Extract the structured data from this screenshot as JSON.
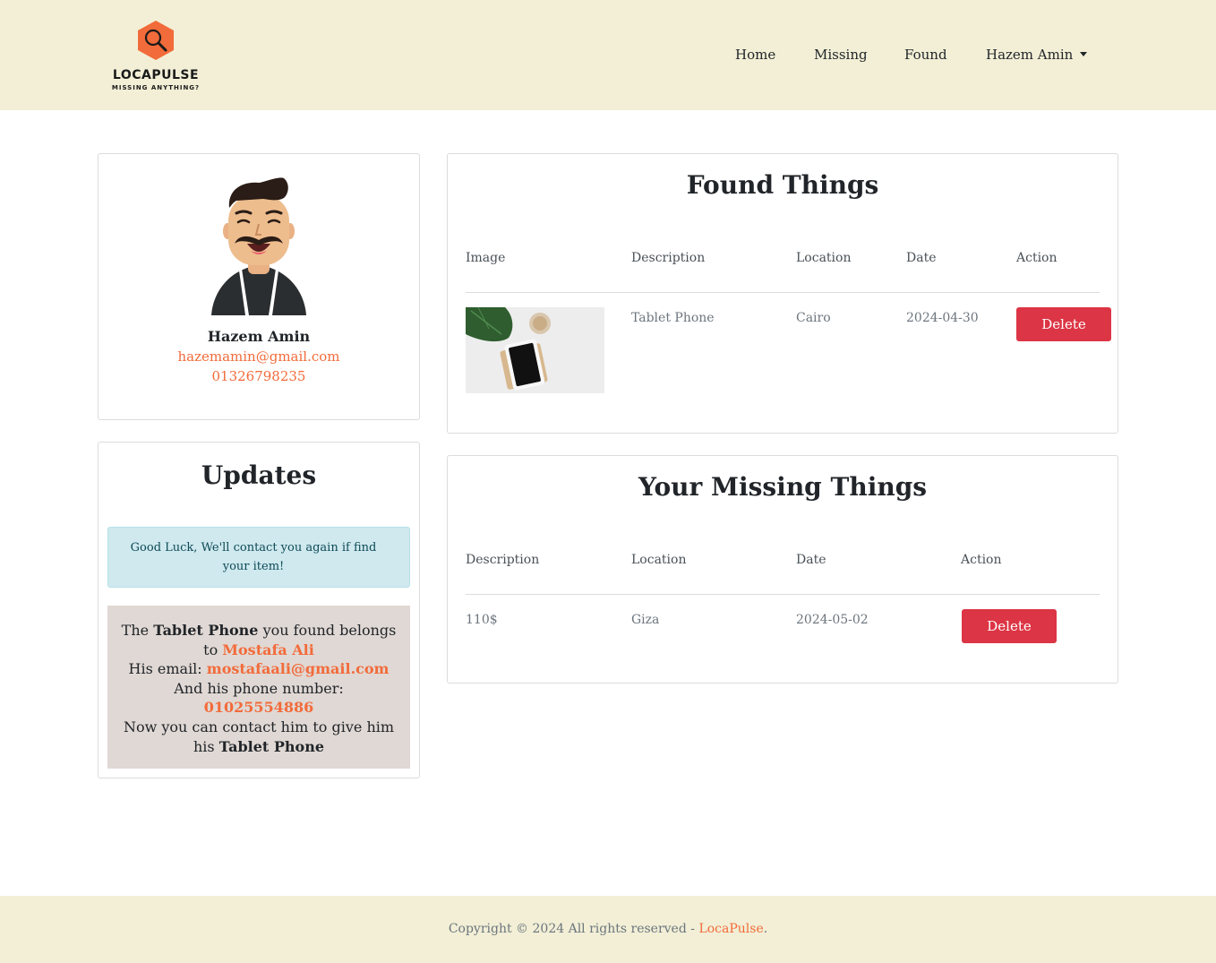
{
  "header": {
    "brand": "LOCAPULSE",
    "tagline": "MISSING ANYTHING?",
    "nav": {
      "home": "Home",
      "missing": "Missing",
      "found": "Found",
      "user": "Hazem Amin"
    }
  },
  "profile": {
    "name": "Hazem Amin",
    "email": "hazemamin@gmail.com",
    "phone": "01326798235"
  },
  "updates": {
    "title": "Updates",
    "info": "Good Luck, We'll contact you again if find your item!",
    "notice": {
      "p1": "The ",
      "item1": "Tablet Phone",
      "p2": " you found belongs to ",
      "owner": "Mostafa Ali",
      "p3": "His email: ",
      "owner_email": "mostafaali@gmail.com",
      "p4": "And his phone number: ",
      "owner_phone": "01025554886",
      "p5": "Now you can contact him to give him his ",
      "item2": "Tablet Phone"
    }
  },
  "found": {
    "title": "Found Things",
    "headers": [
      "Image",
      "Description",
      "Location",
      "Date",
      "Action"
    ],
    "rows": [
      {
        "description": "Tablet Phone",
        "location": "Cairo",
        "date": "2024-04-30",
        "action": "Delete"
      }
    ]
  },
  "missing": {
    "title": "Your Missing Things",
    "headers": [
      "Description",
      "Location",
      "Date",
      "Action"
    ],
    "rows": [
      {
        "description": "110$",
        "location": "Giza",
        "date": "2024-05-02",
        "action": "Delete"
      }
    ]
  },
  "footer": {
    "text": "Copyright © 2024 All rights reserved - ",
    "brand": "LocaPulse",
    "end": "."
  },
  "colors": {
    "accent": "#f26b3a",
    "danger": "#dc3545",
    "header_bg": "#f2efd6",
    "info_bg": "#cfe9ef"
  }
}
